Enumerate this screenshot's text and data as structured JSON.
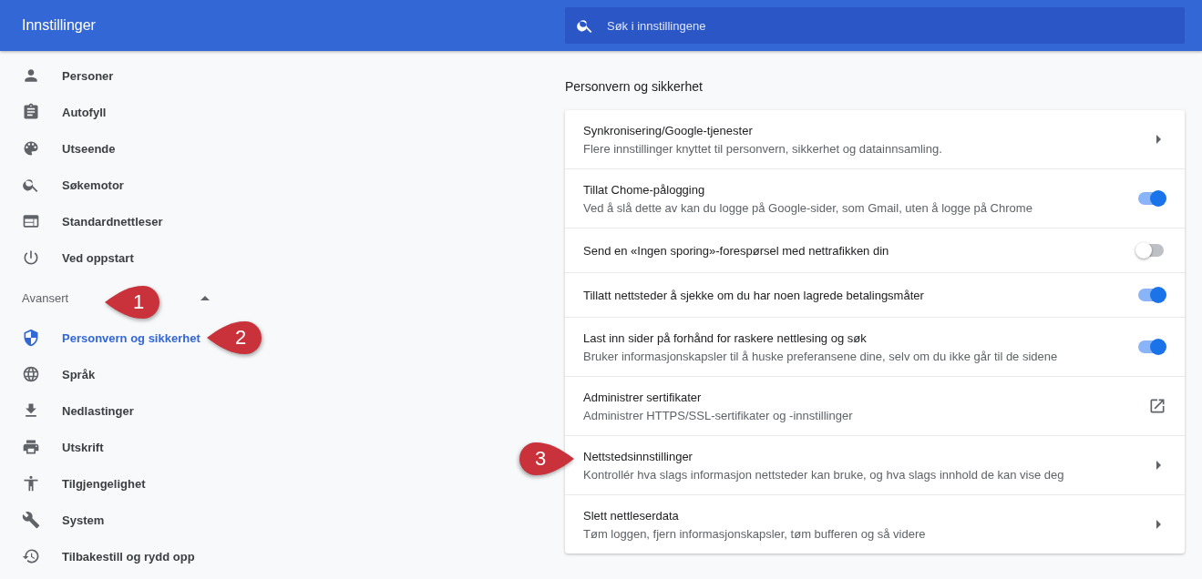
{
  "header": {
    "title": "Innstillinger",
    "search": {
      "placeholder": "Søk i innstillingene"
    }
  },
  "sidebar": {
    "items": [
      {
        "label": "Personer",
        "selected": false
      },
      {
        "label": "Autofyll",
        "selected": false
      },
      {
        "label": "Utseende",
        "selected": false
      },
      {
        "label": "Søkemotor",
        "selected": false
      },
      {
        "label": "Standardnettleser",
        "selected": false
      },
      {
        "label": "Ved oppstart",
        "selected": false
      }
    ],
    "advanced": {
      "label": "Avansert",
      "expanded": true,
      "items": [
        {
          "label": "Personvern og sikkerhet",
          "selected": true
        },
        {
          "label": "Språk",
          "selected": false
        },
        {
          "label": "Nedlastinger",
          "selected": false
        },
        {
          "label": "Utskrift",
          "selected": false
        },
        {
          "label": "Tilgjengelighet",
          "selected": false
        },
        {
          "label": "System",
          "selected": false
        },
        {
          "label": "Tilbakestill og rydd opp",
          "selected": false
        }
      ]
    }
  },
  "section": {
    "title": "Personvern og sikkerhet",
    "rows": [
      {
        "kind": "link",
        "title": "Synkronisering/Google-tjenester",
        "description": "Flere innstillinger knyttet til personvern, sikkerhet og datainnsamling."
      },
      {
        "kind": "toggle",
        "title": "Tillat Chome-pålogging",
        "description": "Ved å slå dette av kan du logge på Google-sider, som Gmail, uten å logge på Chrome",
        "on": true
      },
      {
        "kind": "toggle",
        "title": "Send en «Ingen sporing»-forespørsel med nettrafikken din",
        "on": false
      },
      {
        "kind": "toggle",
        "title": "Tillatt nettsteder å sjekke om du har noen lagrede betalingsmåter",
        "on": true
      },
      {
        "kind": "toggle",
        "title": "Last inn sider på forhånd for raskere nettlesing og søk",
        "description": "Bruker informasjonskapsler til å huske preferansene dine, selv om du ikke går til de sidene",
        "on": true
      },
      {
        "kind": "external",
        "title": "Administrer sertifikater",
        "description": "Administrer HTTPS/SSL-sertifikater og -innstillinger"
      },
      {
        "kind": "link",
        "title": "Nettstedsinnstillinger",
        "description": "Kontrollér hva slags informasjon nettsteder kan bruke, og hva slags innhold de kan vise deg"
      },
      {
        "kind": "link",
        "title": "Slett nettleserdata",
        "description": "Tøm loggen, fjern informasjonskapsler, tøm bufferen og så videre"
      }
    ]
  },
  "callouts": [
    {
      "label": "1"
    },
    {
      "label": "2"
    },
    {
      "label": "3"
    }
  ]
}
